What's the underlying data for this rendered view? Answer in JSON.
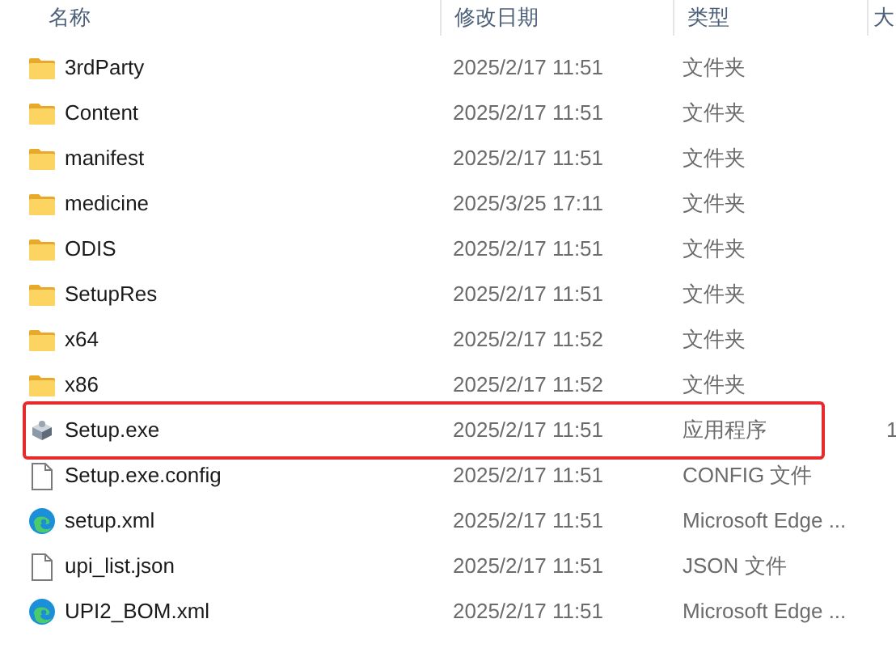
{
  "columns": [
    {
      "label": "名称"
    },
    {
      "label": "修改日期"
    },
    {
      "label": "类型"
    },
    {
      "label": "大"
    }
  ],
  "rows": [
    {
      "kind": "folder",
      "name": "3rdParty",
      "date": "2025/2/17 11:51",
      "type": "文件夹",
      "highlighted": false
    },
    {
      "kind": "folder",
      "name": "Content",
      "date": "2025/2/17 11:51",
      "type": "文件夹",
      "highlighted": false
    },
    {
      "kind": "folder",
      "name": "manifest",
      "date": "2025/2/17 11:51",
      "type": "文件夹",
      "highlighted": false
    },
    {
      "kind": "folder",
      "name": "medicine",
      "date": "2025/3/25 17:11",
      "type": "文件夹",
      "highlighted": false
    },
    {
      "kind": "folder",
      "name": "ODIS",
      "date": "2025/2/17 11:51",
      "type": "文件夹",
      "highlighted": false
    },
    {
      "kind": "folder",
      "name": "SetupRes",
      "date": "2025/2/17 11:51",
      "type": "文件夹",
      "highlighted": false
    },
    {
      "kind": "folder",
      "name": "x64",
      "date": "2025/2/17 11:52",
      "type": "文件夹",
      "highlighted": false
    },
    {
      "kind": "folder",
      "name": "x86",
      "date": "2025/2/17 11:52",
      "type": "文件夹",
      "highlighted": false
    },
    {
      "kind": "app",
      "name": "Setup.exe",
      "date": "2025/2/17 11:51",
      "type": "应用程序",
      "size": "1",
      "highlighted": true
    },
    {
      "kind": "file",
      "name": "Setup.exe.config",
      "date": "2025/2/17 11:51",
      "type": "CONFIG 文件",
      "highlighted": false
    },
    {
      "kind": "edge",
      "name": "setup.xml",
      "date": "2025/2/17 11:51",
      "type": "Microsoft Edge ...",
      "highlighted": false
    },
    {
      "kind": "file",
      "name": "upi_list.json",
      "date": "2025/2/17 11:51",
      "type": "JSON 文件",
      "highlighted": false
    },
    {
      "kind": "edge",
      "name": "UPI2_BOM.xml",
      "date": "2025/2/17 11:51",
      "type": "Microsoft Edge ...",
      "highlighted": false
    }
  ]
}
